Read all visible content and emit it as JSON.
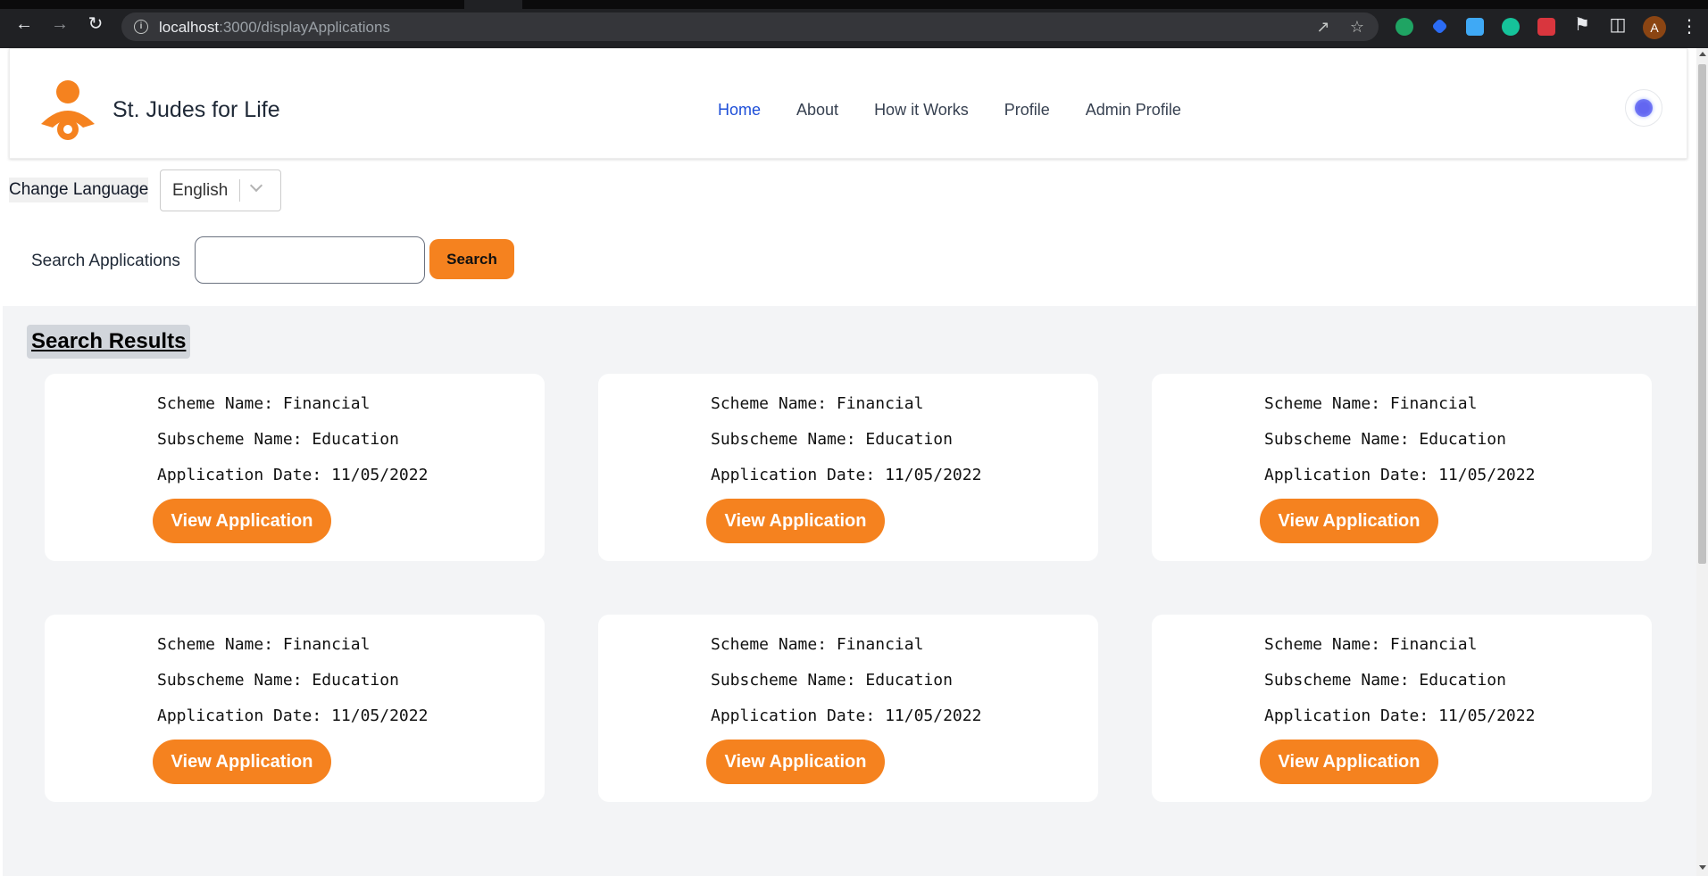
{
  "browser": {
    "url_host": "localhost",
    "url_path": ":3000/displayApplications",
    "profile_initial": "A"
  },
  "header": {
    "brand": "St. Judes for Life",
    "nav": [
      "Home",
      "About",
      "How it Works",
      "Profile",
      "Admin Profile"
    ],
    "active_nav": "Home",
    "brand_color": "#f5821f"
  },
  "language": {
    "label": "Change Language",
    "selected": "English"
  },
  "search": {
    "label": "Search Applications",
    "value": "",
    "button": "Search"
  },
  "results": {
    "title": "Search Results",
    "cards": [
      {
        "scheme": "Scheme Name: Financial",
        "subscheme": "Subscheme Name: Education",
        "date": "Application Date: 11/05/2022",
        "button": "View Application"
      },
      {
        "scheme": "Scheme Name: Financial",
        "subscheme": "Subscheme Name: Education",
        "date": "Application Date: 11/05/2022",
        "button": "View Application"
      },
      {
        "scheme": "Scheme Name: Financial",
        "subscheme": "Subscheme Name: Education",
        "date": "Application Date: 11/05/2022",
        "button": "View Application"
      },
      {
        "scheme": "Scheme Name: Financial",
        "subscheme": "Subscheme Name: Education",
        "date": "Application Date: 11/05/2022",
        "button": "View Application"
      },
      {
        "scheme": "Scheme Name: Financial",
        "subscheme": "Subscheme Name: Education",
        "date": "Application Date: 11/05/2022",
        "button": "View Application"
      },
      {
        "scheme": "Scheme Name: Financial",
        "subscheme": "Subscheme Name: Education",
        "date": "Application Date: 11/05/2022",
        "button": "View Application"
      }
    ]
  }
}
